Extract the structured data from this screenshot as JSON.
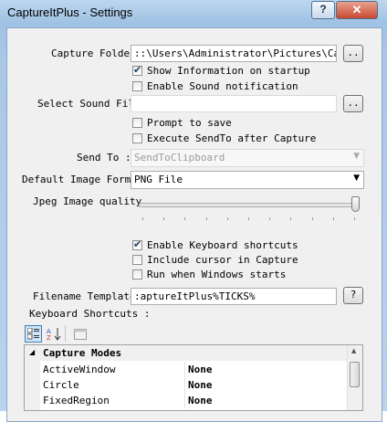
{
  "window": {
    "title": "CaptureItPlus - Settings",
    "help_label": "?",
    "close_label": "✕"
  },
  "capture_folder": {
    "label": "Capture Folder",
    "value": "::\\Users\\Administrator\\Pictures\\Captu",
    "browse_label": ".."
  },
  "show_info": {
    "label": "Show Information on startup",
    "checked": true
  },
  "sound_notification": {
    "label": "Enable Sound notification",
    "checked": false
  },
  "sound_file": {
    "label": "Select Sound File",
    "value": "",
    "browse_label": ".."
  },
  "prompt_save": {
    "label": "Prompt to save",
    "checked": false
  },
  "execute_sendto": {
    "label": "Execute SendTo after Capture",
    "checked": false
  },
  "send_to": {
    "label": "Send To :",
    "value": "SendToClipboard"
  },
  "image_format": {
    "label": "Default Image Format",
    "value": "PNG File"
  },
  "jpeg_quality": {
    "label": "Jpeg Image quality",
    "level": 1.0
  },
  "keyboard_shortcuts_enabled": {
    "label": "Enable Keyboard shortcuts",
    "checked": true
  },
  "include_cursor": {
    "label": "Include cursor in Capture",
    "checked": false
  },
  "run_on_start": {
    "label": "Run when Windows starts",
    "checked": false
  },
  "filename_template": {
    "label": "Filename Template",
    "value": ":aptureItPlus%TICKS%",
    "help_label": "?"
  },
  "keyboard_shortcuts": {
    "label": "Keyboard Shortcuts :"
  },
  "toolbar": {
    "icons": [
      "categorized-icon",
      "alphabetical-sort-icon",
      "property-pages-icon"
    ]
  },
  "property_grid": {
    "category": "Capture Modes",
    "rows": [
      {
        "name": "ActiveWindow",
        "value": "None"
      },
      {
        "name": "Circle",
        "value": "None"
      },
      {
        "name": "FixedRegion",
        "value": "None"
      }
    ]
  }
}
